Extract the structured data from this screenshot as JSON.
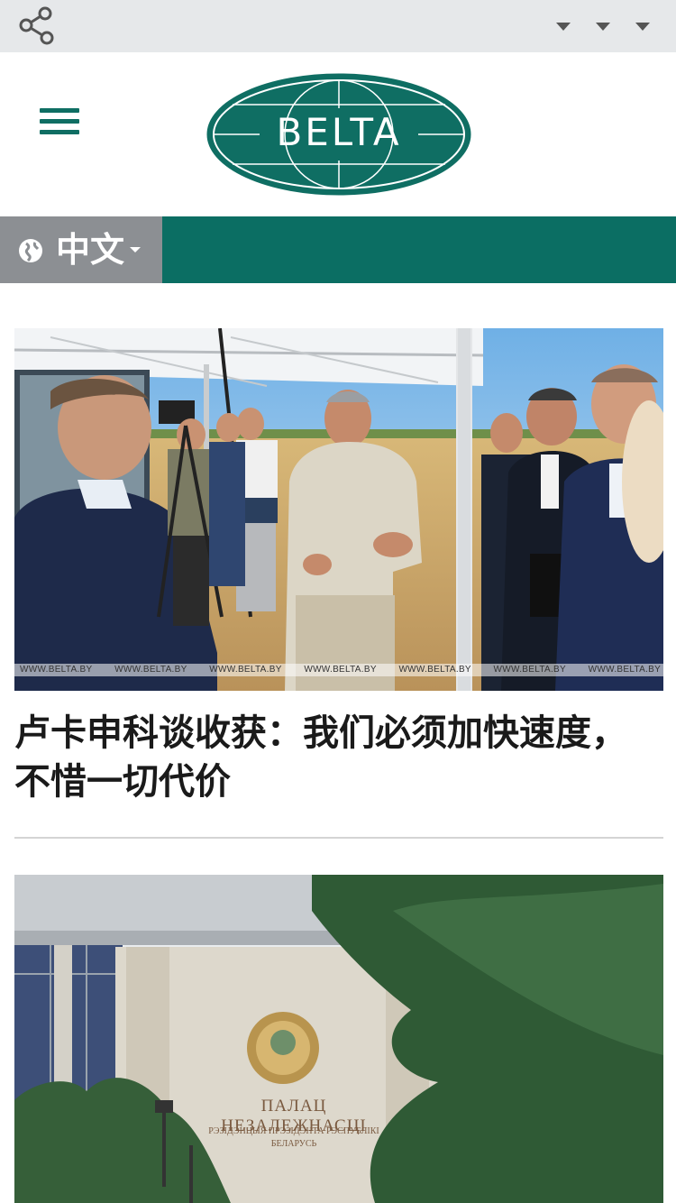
{
  "topbar": {
    "share_icon": "share-icon",
    "dropdowns": 3,
    "background": "#e6e8ea"
  },
  "header": {
    "menu_icon": "hamburger-icon",
    "logo_text": "BELTA",
    "brand_color": "#0f6e63"
  },
  "language": {
    "icon": "globe-icon",
    "current": "中文",
    "bar_color": "#0b6e63",
    "selector_color": "#8c8f93"
  },
  "articles": [
    {
      "headline": "卢卡申科谈收获：我们必须加快速度，不惜一切代价",
      "watermark": "WWW.BELTA.BY"
    },
    {
      "sign_text": "ПАЛАЦ НЕЗАЛЕЖНАСЦІ",
      "sign_subtext": "РЭЗІДЭНЦЫЯ ПРЭЗІДЭНТА РЭСПУБЛІКІ БЕЛАРУСЬ"
    }
  ]
}
